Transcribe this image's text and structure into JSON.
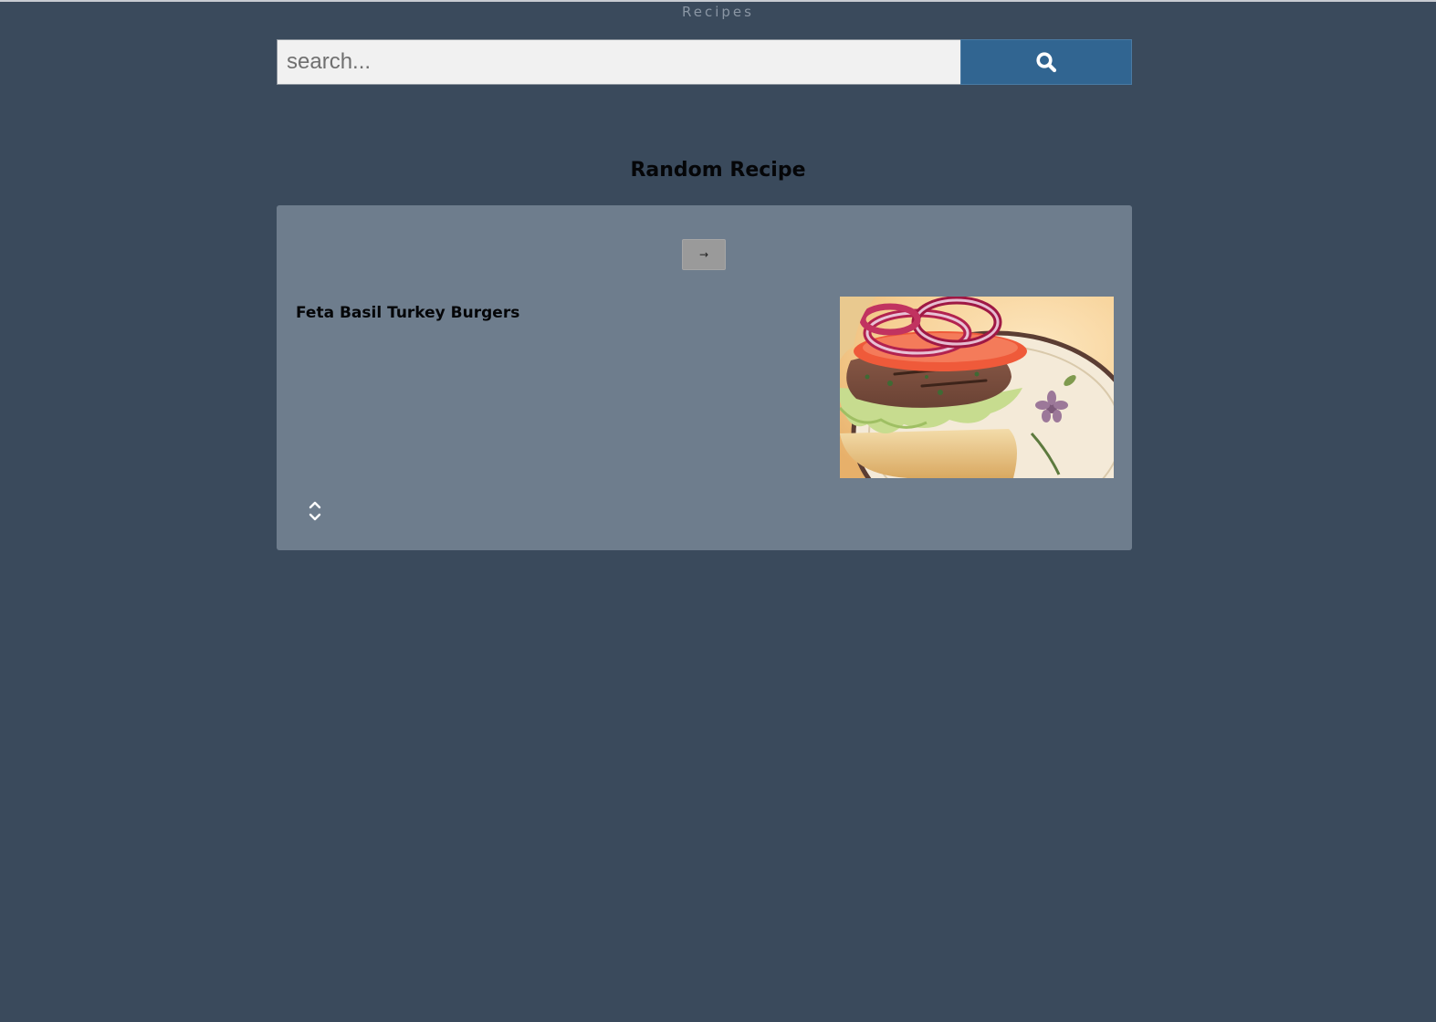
{
  "app": {
    "title": "Recipes"
  },
  "search": {
    "placeholder": "search...",
    "value": "",
    "button_icon": "search-icon"
  },
  "random_section": {
    "heading": "Random Recipe",
    "next_button_label": "→",
    "recipe": {
      "title": "Feta Basil Turkey Burgers",
      "image_subject": "turkey burger with red onion, tomato and lettuce on a bun"
    },
    "expand_icon": "expand-collapse-icon"
  },
  "colors": {
    "page_background": "#3a4a5c",
    "card_background": "#6e7d8d",
    "search_button": "#316591",
    "search_input_background": "#f1f1f1",
    "next_button": "#9a9a9a"
  }
}
